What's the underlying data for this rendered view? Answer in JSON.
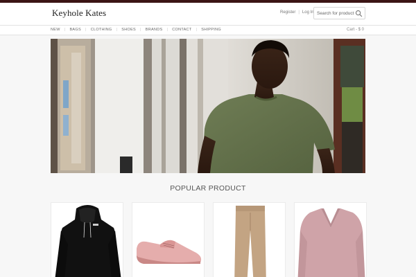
{
  "header": {
    "logo": "Keyhole Kates",
    "register": "Register",
    "login": "Log In",
    "search_placeholder": "Search for product"
  },
  "nav": {
    "items": [
      {
        "label": "NEW"
      },
      {
        "label": "BAGS"
      },
      {
        "label": "CLOTHING"
      },
      {
        "label": "SHOES"
      },
      {
        "label": "BRANDS"
      },
      {
        "label": "CONTACT"
      },
      {
        "label": "SHIPPING"
      }
    ],
    "cart": "Cart - $ 0"
  },
  "section": {
    "title": "POPULAR PRODUCT"
  },
  "products": [
    {
      "icon": "black-hoodie-image"
    },
    {
      "icon": "pink-shoe-image"
    },
    {
      "icon": "khaki-trousers-image"
    },
    {
      "icon": "pink-sweater-image"
    }
  ],
  "colors": {
    "topbar": "#3b1414",
    "background": "#f7f7f7"
  }
}
